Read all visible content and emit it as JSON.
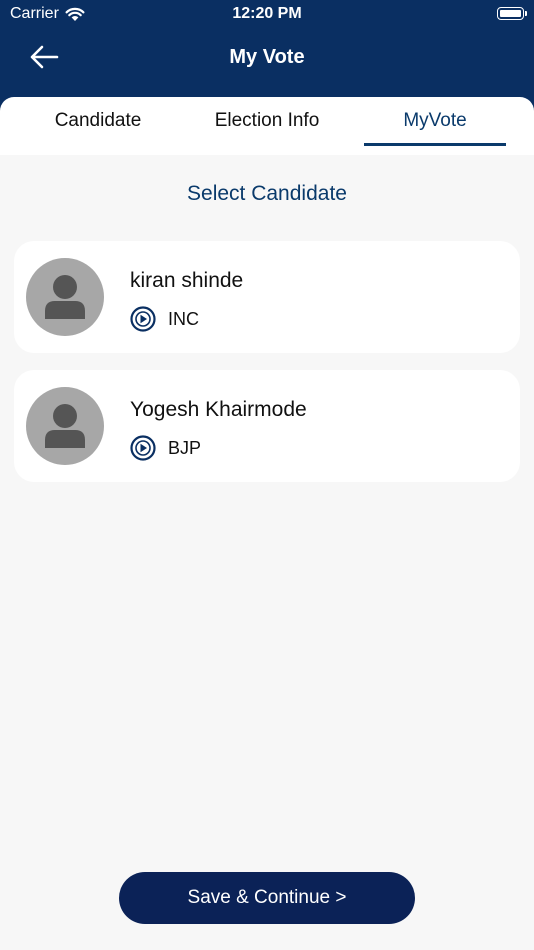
{
  "status_bar": {
    "carrier": "Carrier",
    "time": "12:20 PM"
  },
  "nav": {
    "title": "My Vote"
  },
  "tabs": [
    {
      "label": "Candidate"
    },
    {
      "label": "Election Info"
    },
    {
      "label": "MyVote",
      "active": true
    }
  ],
  "section": {
    "title": "Select Candidate"
  },
  "candidates": [
    {
      "name": "kiran shinde",
      "party": "INC"
    },
    {
      "name": "Yogesh Khairmode",
      "party": "BJP"
    }
  ],
  "actions": {
    "save_label": "Save & Continue >"
  },
  "colors": {
    "header_bg": "#0A2F62",
    "accent": "#0A3A6B",
    "button_bg": "#0B2257",
    "page_bg": "#F7F7F7",
    "avatar_bg": "#A7A7A7"
  },
  "icons": {
    "back": "arrow-left-icon",
    "wifi": "wifi-icon",
    "battery": "battery-icon",
    "avatar": "person-icon",
    "party": "play-circle-icon"
  }
}
